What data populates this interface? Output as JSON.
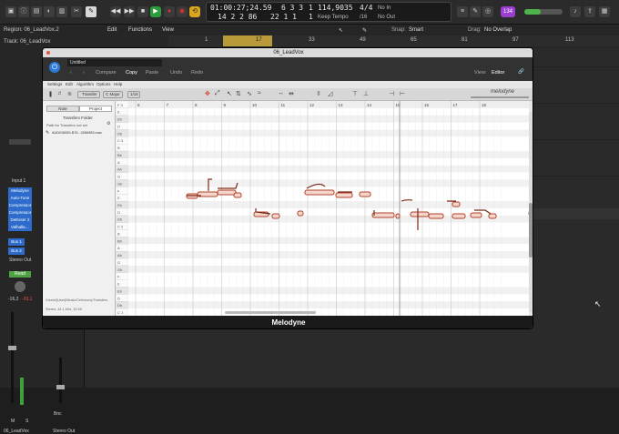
{
  "top": {
    "lcd": {
      "time": "01:00:27;24.59",
      "bars": "6 3 3",
      "beat": "1",
      "tempo": "114,9035",
      "sig": "4/4",
      "sub_time": "14 2 2 86",
      "sub_bars": "22 1 1",
      "sub_beat": "1",
      "tempo_mode": "Keep Tempo",
      "div": "/16",
      "no_in": "No In",
      "no_out": "No Out"
    },
    "badge": "134",
    "transport_icons": [
      "rewind-icon",
      "fast-forward-icon",
      "stop-icon",
      "play-icon",
      "record-icon",
      "capture-icon",
      "cycle-icon"
    ]
  },
  "header": {
    "region": "Region: 06_LeadVox.2",
    "track": "Track: 06_LeadVox",
    "menus": [
      "Edit",
      "Functions",
      "View"
    ],
    "snap_label": "Snap:",
    "snap_value": "Smart",
    "drag_label": "Drag:",
    "drag_value": "No Overlap",
    "ruler": [
      "1",
      "17",
      "33",
      "49",
      "65",
      "81",
      "97",
      "113"
    ]
  },
  "inspector": {
    "input": "Input 1",
    "plugins": [
      "Melodyne",
      "Auto-Tune",
      "Compressor",
      "Compressor",
      "DeEsser 2",
      "Valhalla…"
    ],
    "sends": [
      "Bus 1",
      "Bus 2"
    ],
    "output": "Stereo Out",
    "mode": "Read",
    "vol_left": "-16,2",
    "vol_right": "-20,1",
    "ms": [
      "M",
      "S",
      "M",
      "S"
    ],
    "bnc": "Bnc",
    "track_left": "06_LeadVox",
    "track_right": "Stereo Out"
  },
  "plugin": {
    "title": "06_LeadVox",
    "preset": "Untitled",
    "nav": [
      "Compare",
      "Copy",
      "Paste",
      "Undo",
      "Redo"
    ],
    "view_label": "View:",
    "view_value": "Editor",
    "menu": [
      "Settings",
      "Edit",
      "Algorithm",
      "Options",
      "Help"
    ],
    "tool_labels": [
      "Transfer",
      "C Major",
      "1/16"
    ],
    "logo": "melodyne",
    "side_tabs": [
      "Note",
      "Project"
    ],
    "folder": "Transfers Folder",
    "path": "Path for Transfers not set",
    "file": "AUDIO6059-B76...3266983.mas",
    "footer_path": "/Users/[User]/Music/Celemony/Transfers",
    "footer_info": "Stereo, 44.1 kHz, 32 bit",
    "grid_bars": [
      "6",
      "7",
      "8",
      "9",
      "10",
      "11",
      "12",
      "13",
      "14",
      "15",
      "16",
      "17",
      "18"
    ],
    "keys": [
      "F 3",
      "E",
      "Eb",
      "D",
      "Db",
      "C 3",
      "B",
      "Bb",
      "A",
      "Ab",
      "G",
      "Gb",
      "F",
      "E",
      "Eb",
      "D",
      "Db",
      "C 2",
      "B",
      "Bb",
      "A",
      "Ab",
      "G",
      "Gb",
      "F",
      "E",
      "Eb",
      "D",
      "Db",
      "C 1"
    ],
    "footer_label": "Melodyne"
  }
}
